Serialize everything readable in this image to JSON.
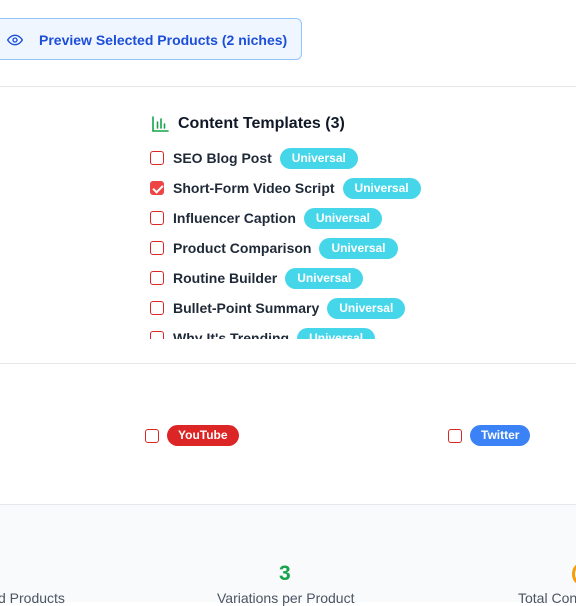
{
  "preview": {
    "label": "Preview Selected Products (2 niches)",
    "icon": "eye-icon"
  },
  "templates": {
    "title": "Content Templates (3)",
    "icon": "bar-chart-icon",
    "items": [
      {
        "name": "SEO Blog Post",
        "badge": "Universal",
        "checked": false
      },
      {
        "name": "Short-Form Video Script",
        "badge": "Universal",
        "checked": true
      },
      {
        "name": "Influencer Caption",
        "badge": "Universal",
        "checked": false
      },
      {
        "name": "Product Comparison",
        "badge": "Universal",
        "checked": false
      },
      {
        "name": "Routine Builder",
        "badge": "Universal",
        "checked": false
      },
      {
        "name": "Bullet-Point Summary",
        "badge": "Universal",
        "checked": false
      },
      {
        "name": "Why It's Trending",
        "badge": "Universal",
        "checked": false
      }
    ]
  },
  "platforms": [
    {
      "name": "YouTube",
      "color": "#dc2626",
      "checked": false
    },
    {
      "name": "Twitter",
      "color": "#3b82f6",
      "checked": false
    }
  ],
  "stats": {
    "left_label": "d Products",
    "middle_value": "3",
    "middle_label": "Variations per Product",
    "right_label": "Total Con"
  },
  "colors": {
    "accent_blue": "#1d4ed8",
    "badge_cyan": "#45d6ea",
    "checkbox_red": "#dc2626",
    "stat_green": "#16a34a",
    "right_stat_orange": "#f59e0b"
  }
}
